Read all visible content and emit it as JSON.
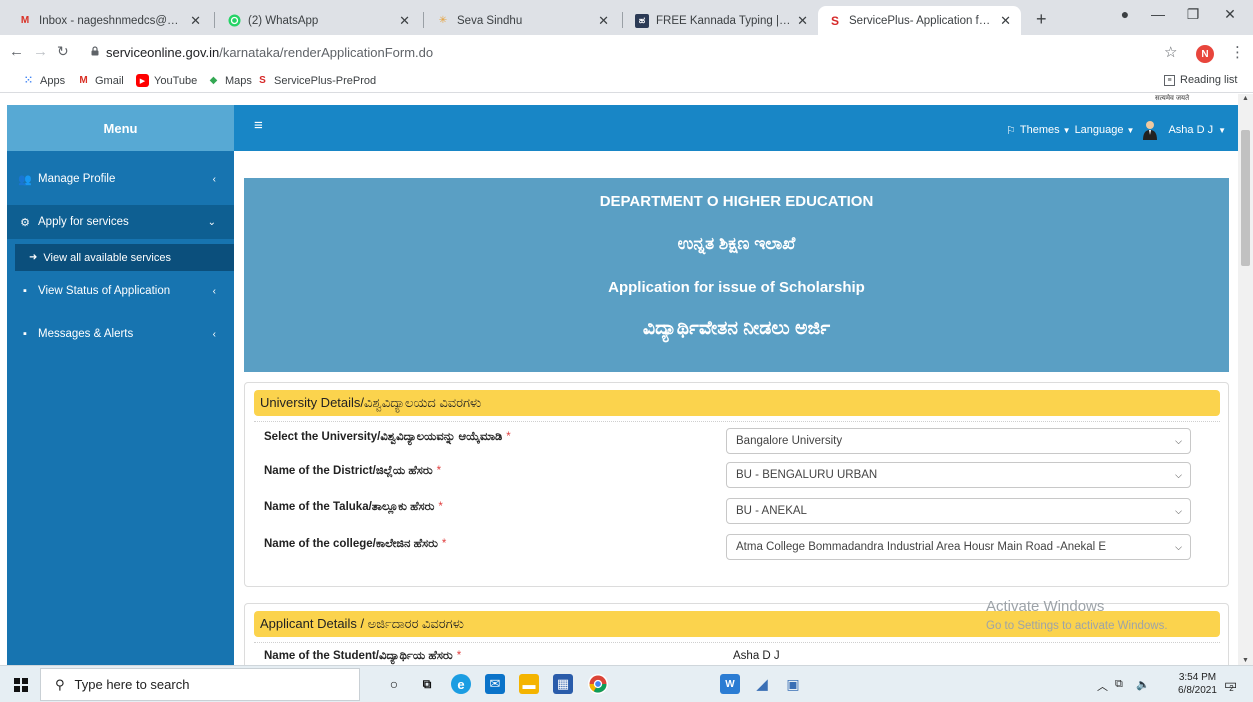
{
  "browser": {
    "tabs": [
      {
        "label": "Inbox - nageshnmedcs@gma",
        "icon": "gmail-icon",
        "active": false
      },
      {
        "label": "(2) WhatsApp",
        "icon": "whatsapp-icon",
        "active": false
      },
      {
        "label": "Seva Sindhu",
        "icon": "seva-sindhu-icon",
        "active": false
      },
      {
        "label": "FREE Kannada Typing | Englis",
        "icon": "kannada-typing-icon",
        "active": false
      },
      {
        "label": "ServicePlus- Application for is",
        "icon": "serviceplus-icon",
        "active": true
      }
    ],
    "url_domain": "serviceonline.gov.in",
    "url_path": "/karnataka/renderApplicationForm.do",
    "profile_initial": "N",
    "bookmarks": [
      {
        "label": "Apps",
        "icon": "apps-grid-icon"
      },
      {
        "label": "Gmail",
        "icon": "gmail-icon"
      },
      {
        "label": "YouTube",
        "icon": "youtube-icon"
      },
      {
        "label": "Maps",
        "icon": "maps-icon"
      },
      {
        "label": "ServicePlus-PreProd",
        "icon": "serviceplus-icon"
      }
    ],
    "reading_list": "Reading list"
  },
  "app": {
    "emblem_text": "सत्यमेव जयते",
    "menu_title": "Menu",
    "sidebar": [
      {
        "label": "Manage Profile",
        "icon": "users-icon",
        "open": false
      },
      {
        "label": "Apply for services",
        "icon": "gears-icon",
        "open": true
      },
      {
        "label": "View Status of Application",
        "icon": "card-icon",
        "open": false
      },
      {
        "label": "Messages & Alerts",
        "icon": "card-icon",
        "open": false
      }
    ],
    "sub_item": "View all available services",
    "topbar": {
      "themes": "Themes",
      "language": "Language",
      "user": "Asha D J"
    }
  },
  "banner": {
    "line1": "DEPARTMENT O HIGHER EDUCATION",
    "line2": "ಉನ್ನತ ಶಿಕ್ಷಣ ಇಲಾಖೆ",
    "line3": "Application for issue of Scholarship",
    "line4": "ವಿದ್ಯಾರ್ಥಿವೇತನ ನೀಡಲು ಅರ್ಜಿ"
  },
  "university_section": {
    "title": "University Details/ವಿಶ್ವವಿದ್ಯಾಲಯದ ವಿವರಗಳು",
    "fields": [
      {
        "label": "Select the University/ವಿಶ್ವವಿದ್ಯಾಲಯವನ್ನು ಆಯ್ಕೆಮಾಡಿ",
        "value": "Bangalore University"
      },
      {
        "label": "Name of the District/ಜಿಲ್ಲೆಯ ಹೆಸರು",
        "value": "BU - BENGALURU URBAN"
      },
      {
        "label": "Name of the Taluka/ತಾಲ್ಲೂಕು ಹೆಸರು",
        "value": "BU - ANEKAL"
      },
      {
        "label": "Name of the college/ಕಾಲೇಜಿನ ಹೆಸರು",
        "value": "Atma College Bommadandra Industrial Area Housr Main Road -Anekal E"
      }
    ]
  },
  "applicant_section": {
    "title": "Applicant Details / ಅರ್ಜಿದಾರರ ವಿವರಗಳು",
    "student_label": "Name of the Student/ವಿದ್ಯಾರ್ಥಿಯ ಹೆಸರು",
    "student_value": "Asha D J"
  },
  "required_mark": "*",
  "watermark": {
    "line1": "Activate Windows",
    "line2": "Go to Settings to activate Windows."
  },
  "taskbar": {
    "search_placeholder": "Type here to search",
    "time": "3:54 PM",
    "date": "6/8/2021",
    "notification_count": "2"
  }
}
